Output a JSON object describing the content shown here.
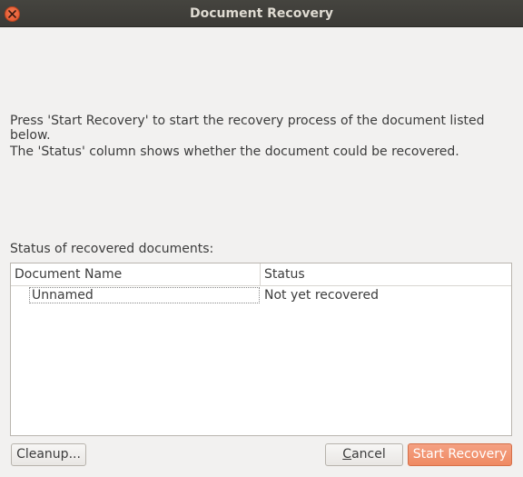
{
  "window": {
    "title": "Document Recovery"
  },
  "intro": {
    "line1": "Press 'Start Recovery' to start the recovery process of the document listed below.",
    "line2": "The 'Status' column shows whether the document could be recovered."
  },
  "status_section": {
    "label": "Status of recovered documents:"
  },
  "table": {
    "columns": [
      "Document Name",
      "Status"
    ],
    "rows": [
      {
        "name": "Unnamed",
        "status": "Not yet recovered"
      }
    ]
  },
  "buttons": {
    "cleanup": "Cleanup...",
    "cancel_mnemonic": "C",
    "cancel_rest": "ancel",
    "start_recovery": "Start Recovery"
  },
  "colors": {
    "titlebar": "#3b3a36",
    "close_button": "#e0532a",
    "accent_button": "#ef8a62",
    "background": "#f2f1f0"
  },
  "icons": {
    "close": "close-icon"
  }
}
